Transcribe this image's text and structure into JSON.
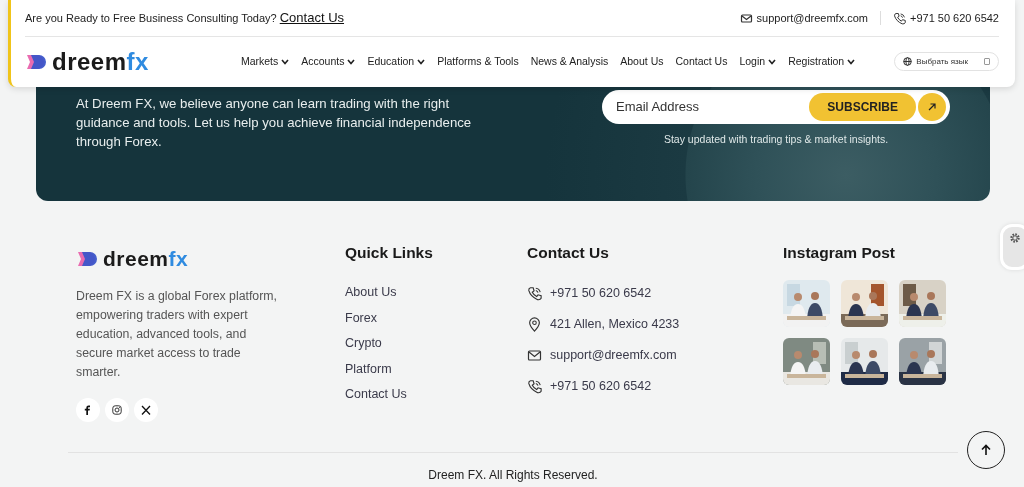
{
  "top_bar": {
    "prompt": "Are you Ready to Free Business Consulting Today?",
    "link": "Contact Us",
    "email": "support@dreemfx.com",
    "phone": "+971 50 620 6542"
  },
  "nav": {
    "logo": {
      "text": "dreem",
      "accent": "fx"
    },
    "items": [
      {
        "label": "Markets",
        "dropdown": true
      },
      {
        "label": "Accounts",
        "dropdown": true
      },
      {
        "label": "Education",
        "dropdown": true
      },
      {
        "label": "Platforms & Tools",
        "dropdown": false
      },
      {
        "label": "News & Analysis",
        "dropdown": false
      },
      {
        "label": "About Us",
        "dropdown": false
      },
      {
        "label": "Contact Us",
        "dropdown": false
      },
      {
        "label": "Login",
        "dropdown": true
      },
      {
        "label": "Registration",
        "dropdown": true
      }
    ],
    "language": {
      "label": "Выбрать язык"
    }
  },
  "banner": {
    "text": "At Dreem FX, we believe anyone can learn trading with the right guidance and tools. Let us help you achieve financial independence through Forex.",
    "email_placeholder": "Email Address",
    "subscribe": "SUBSCRIBE",
    "caption": "Stay updated with trading tips & market insights."
  },
  "footer": {
    "logo": {
      "text": "dreem",
      "accent": "fx"
    },
    "about": "Dreem FX is a global Forex platform, empowering traders with expert education, advanced tools, and secure market access to trade smarter.",
    "social": [
      {
        "kind": "facebook"
      },
      {
        "kind": "instagram"
      },
      {
        "kind": "x"
      }
    ],
    "quick_links": {
      "title": "Quick Links",
      "items": [
        "About Us",
        "Forex",
        "Crypto",
        "Platform",
        "Contact Us"
      ]
    },
    "contact": {
      "title": "Contact Us",
      "items": [
        {
          "kind": "phone",
          "text": "+971 50 620 6542"
        },
        {
          "kind": "location",
          "text": "421 Allen, Mexico 4233"
        },
        {
          "kind": "email",
          "text": "support@dreemfx.com"
        },
        {
          "kind": "phone",
          "text": "+971 50 620 6542"
        }
      ]
    },
    "instagram": {
      "title": "Instagram Post"
    },
    "copyright": "Dreem FX. All Rights Reserved."
  }
}
